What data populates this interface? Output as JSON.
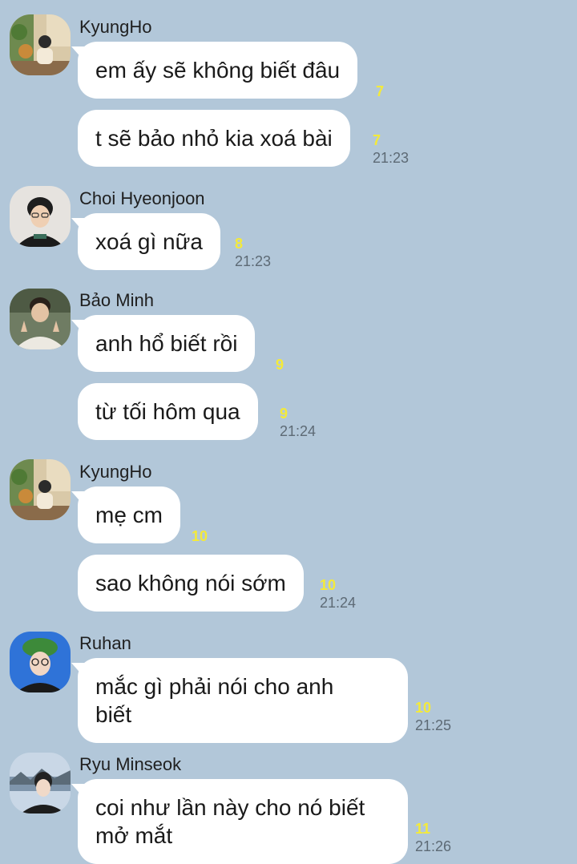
{
  "colors": {
    "background": "#b2c7d9",
    "bubble": "#ffffff",
    "unread": "#f4ea39",
    "time": "#5d6a75"
  },
  "groups": [
    {
      "sender": "KyungHo",
      "avatar_icon": "profile-photo-man-with-plants",
      "messages": [
        {
          "text": "em ấy sẽ không biết đâu",
          "unread": "7",
          "time": ""
        },
        {
          "text": "t sẽ bảo nhỏ kia xoá bài",
          "unread": "7",
          "time": "21:23"
        }
      ]
    },
    {
      "sender": "Choi Hyeonjoon",
      "avatar_icon": "profile-photo-man-glasses",
      "messages": [
        {
          "text": "xoá gì nữa",
          "unread": "8",
          "time": "21:23"
        }
      ]
    },
    {
      "sender": "Bảo Minh",
      "avatar_icon": "profile-photo-man-peace-sign",
      "messages": [
        {
          "text": "anh hổ biết rồi",
          "unread": "9",
          "time": ""
        },
        {
          "text": "từ tối hôm qua",
          "unread": "9",
          "time": "21:24"
        }
      ]
    },
    {
      "sender": "KyungHo",
      "avatar_icon": "profile-photo-man-with-plants",
      "messages": [
        {
          "text": "mẹ cm",
          "unread": "10",
          "time": ""
        },
        {
          "text": "sao không nói sớm",
          "unread": "10",
          "time": "21:24"
        }
      ]
    },
    {
      "sender": "Ruhan",
      "avatar_icon": "profile-photo-man-green-hat",
      "messages": [
        {
          "lines": [
            "mắc gì phải nói cho anh",
            "biết"
          ],
          "unread": "10",
          "time": "21:25"
        }
      ]
    },
    {
      "sender": "Ryu Minseok",
      "avatar_icon": "profile-photo-man-scenery",
      "messages": [
        {
          "lines": [
            "coi như lần này cho nó biết",
            "mở mắt"
          ],
          "unread": "11",
          "time": "21:26"
        }
      ]
    }
  ]
}
